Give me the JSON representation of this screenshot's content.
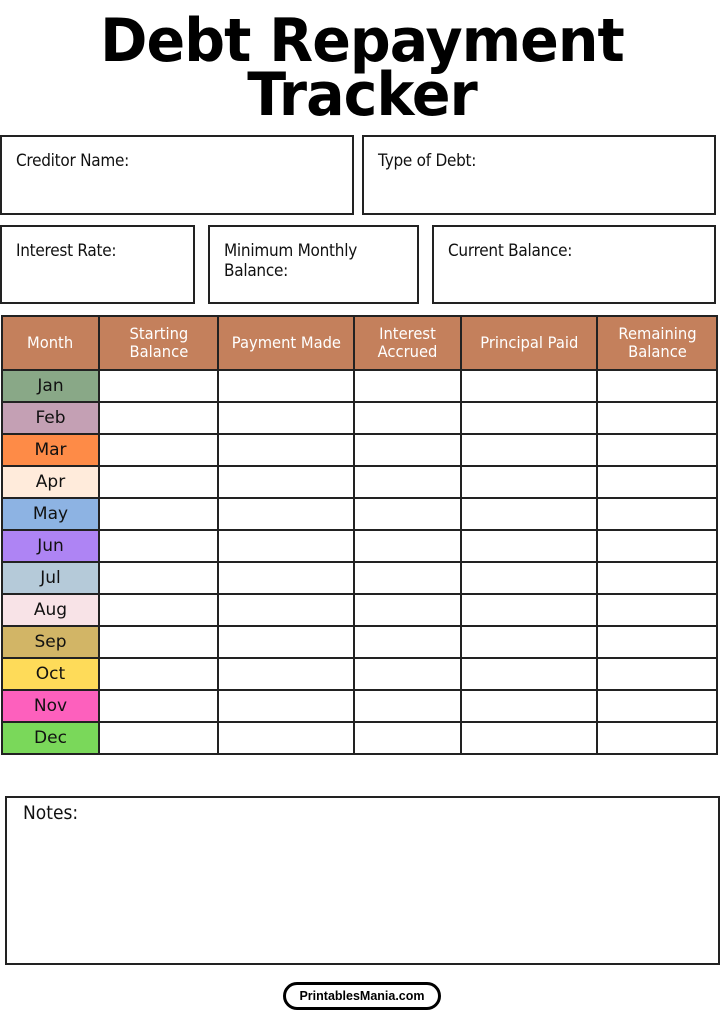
{
  "title": "Debt Repayment\nTracker",
  "title_line1": "Debt Repayment",
  "title_line2": "Tracker",
  "fields": {
    "creditor_name": "Creditor Name:",
    "type_of_debt": "Type of Debt:",
    "interest_rate": "Interest Rate:",
    "minimum_monthly_balance": "Minimum Monthly\nBalance:",
    "current_balance": "Current Balance:"
  },
  "table": {
    "header_color": "#c4805c",
    "columns": [
      "Month",
      "Starting\nBalance",
      "Payment Made",
      "Interest\nAccrued",
      "Principal Paid",
      "Remaining\nBalance"
    ],
    "rows": [
      {
        "month": "Jan",
        "color": "#89a887"
      },
      {
        "month": "Feb",
        "color": "#c4a0b4"
      },
      {
        "month": "Mar",
        "color": "#fe8b47"
      },
      {
        "month": "Apr",
        "color": "#ffebdb"
      },
      {
        "month": "May",
        "color": "#8db3e3"
      },
      {
        "month": "Jun",
        "color": "#ae84f4"
      },
      {
        "month": "Jul",
        "color": "#b5cad9"
      },
      {
        "month": "Aug",
        "color": "#f8e3e7"
      },
      {
        "month": "Sep",
        "color": "#d2b566"
      },
      {
        "month": "Oct",
        "color": "#fedb59"
      },
      {
        "month": "Nov",
        "color": "#fd60bd"
      },
      {
        "month": "Dec",
        "color": "#7ad85a"
      }
    ]
  },
  "notes": {
    "label": "Notes:"
  },
  "footer": {
    "site": "PrintablesMania.com"
  }
}
